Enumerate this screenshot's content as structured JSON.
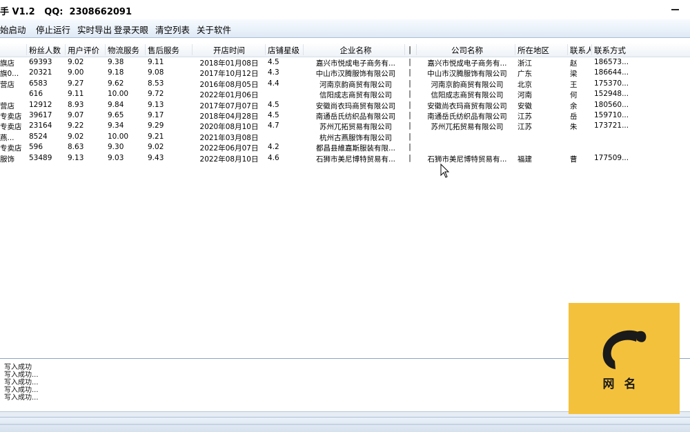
{
  "titlebar": {
    "title": "手 V1.2   QQ:  2308662091"
  },
  "menu": {
    "items": [
      "始启动",
      "停止运行",
      "实时导出",
      "登录天眼",
      "清空列表",
      "关于软件"
    ]
  },
  "table": {
    "columns": [
      "",
      "粉丝人数",
      "用户评价",
      "物流服务",
      "售后服务",
      "开店时间",
      "店铺星级",
      "企业名称",
      "|",
      "公司名称",
      "所在地区",
      "联系人",
      "联系方式"
    ],
    "rows": [
      [
        "旗店",
        "69393",
        "9.02",
        "9.38",
        "9.11",
        "2018年01月08日",
        "4.5",
        "嘉兴市悦成电子商务有...",
        "|",
        "嘉兴市悦成电子商务有...",
        "浙江",
        "赵",
        "186573..."
      ],
      [
        "旗0...",
        "20321",
        "9.00",
        "9.18",
        "9.08",
        "2017年10月12日",
        "4.3",
        "中山市汉腾服饰有限公司",
        "|",
        "中山市汉腾服饰有限公司",
        "广东",
        "梁",
        "186644..."
      ],
      [
        "营店",
        "6583",
        "9.27",
        "9.62",
        "8.53",
        "2016年08月05日",
        "4.4",
        "河南京韵商贸有限公司",
        "|",
        "河南京韵商贸有限公司",
        "北京",
        "王",
        "175370..."
      ],
      [
        "",
        "616",
        "9.11",
        "10.00",
        "9.72",
        "2022年01月06日",
        "",
        "信阳成志商贸有限公司",
        "|",
        "信阳成志商贸有限公司",
        "河南",
        "何",
        "152948..."
      ],
      [
        "营店",
        "12912",
        "8.93",
        "9.84",
        "9.13",
        "2017年07月07日",
        "4.5",
        "安徽尚衣玛商贸有限公司",
        "|",
        "安徽尚衣玛商贸有限公司",
        "安徽",
        "余",
        "180560..."
      ],
      [
        "专卖店",
        "39617",
        "9.07",
        "9.65",
        "9.17",
        "2018年04月28日",
        "4.5",
        "南通岳氏纺织品有限公司",
        "|",
        "南通岳氏纺织品有限公司",
        "江苏",
        "岳",
        "159710..."
      ],
      [
        "专卖店",
        "23164",
        "9.22",
        "9.34",
        "9.29",
        "2020年08月10日",
        "4.7",
        "苏州兀拓贸易有限公司",
        "|",
        "苏州兀拓贸易有限公司",
        "江苏",
        "朱",
        "173721..."
      ],
      [
        "燕...",
        "8524",
        "9.02",
        "10.00",
        "9.21",
        "2021年03月08日",
        "",
        "杭州古燕服饰有限公司",
        "|",
        "",
        "",
        "",
        ""
      ],
      [
        "专卖店",
        "596",
        "8.63",
        "9.30",
        "9.02",
        "2022年06月07日",
        "4.2",
        "都昌县維嘉斯服装有限...",
        "|",
        "",
        "",
        "",
        ""
      ],
      [
        "服饰",
        "53489",
        "9.13",
        "9.03",
        "9.43",
        "2022年08月10日",
        "4.6",
        "石狮市美尼博特贸易有...",
        "|",
        "石狮市美尼博特贸易有...",
        "福建",
        "曹",
        "177509..."
      ]
    ]
  },
  "log": {
    "lines": [
      "写入成功",
      "写入成功...",
      "写入成功...",
      "写入成功...",
      "写入成功..."
    ]
  },
  "watermark": {
    "text": "网名",
    "color": "#f4c13c"
  }
}
